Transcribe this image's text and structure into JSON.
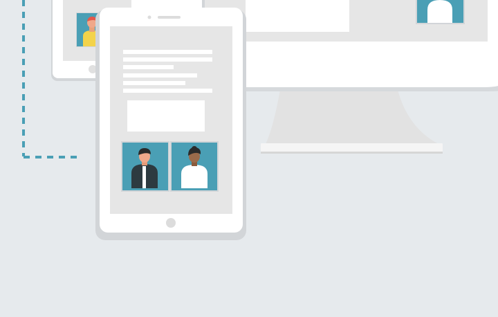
{
  "colors": {
    "background": "#e6eaed",
    "device_shadow": "#d2d5d8",
    "device_frame": "#ffffff",
    "screen": "#e6e6e6",
    "placeholder_line": "#ffffff",
    "connector": "#4a9fb5",
    "avatar_tile": "#4a9fb5",
    "monitor_stand": "#e2e2e2"
  },
  "icons": {
    "home_button": "circle-icon",
    "avatar_yellow": "person-yellow-shirt-icon",
    "avatar_dark": "person-dark-jacket-icon",
    "avatar_white": "person-white-shirt-icon"
  }
}
